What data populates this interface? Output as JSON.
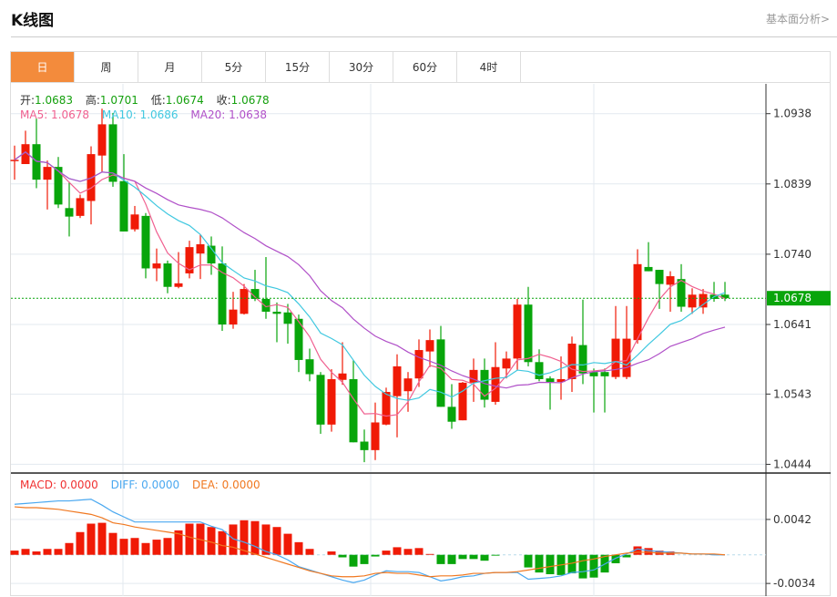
{
  "header": {
    "title": "K线图",
    "link": "基本面分析>"
  },
  "tabs": [
    {
      "label": "日",
      "active": true
    },
    {
      "label": "周"
    },
    {
      "label": "月"
    },
    {
      "label": "5分"
    },
    {
      "label": "15分"
    },
    {
      "label": "30分"
    },
    {
      "label": "60分"
    },
    {
      "label": "4时"
    }
  ],
  "ohlc_legend": {
    "open_label": "开:",
    "open": "1.0683",
    "high_label": "高:",
    "high": "1.0701",
    "low_label": "低:",
    "low": "1.0674",
    "close_label": "收:",
    "close": "1.0678"
  },
  "ma_legend": {
    "ma5": "MA5: 1.0678",
    "ma10": "MA10: 1.0686",
    "ma20": "MA20: 1.0638"
  },
  "macd_legend": {
    "macd": "MACD: 0.0000",
    "diff": "DIFF: 0.0000",
    "dea": "DEA: 0.0000"
  },
  "colors": {
    "up": "#f01a06",
    "down": "#08a50b",
    "ma5": "#f06090",
    "ma10": "#40c8e0",
    "ma20": "#b050c8",
    "diff": "#4aa8f0",
    "dea": "#f07820",
    "accent": "#f38b3c",
    "last_price_bg": "#08a50b"
  },
  "chart_data": [
    {
      "type": "candlestick",
      "title": "K线图",
      "yticks": [
        "1.0938",
        "1.0839",
        "1.0740",
        "1.0641",
        "1.0543",
        "1.0444"
      ],
      "ylim": [
        1.0433,
        1.098
      ],
      "last_price": "1.0678",
      "grid": true,
      "ohlc": [
        [
          1.0872,
          1.0893,
          1.0845,
          1.0873
        ],
        [
          1.0867,
          1.0914,
          1.0867,
          1.0895
        ],
        [
          1.0895,
          1.0931,
          1.0833,
          1.0845
        ],
        [
          1.0845,
          1.0872,
          1.0803,
          1.0863
        ],
        [
          1.0863,
          1.0877,
          1.0805,
          1.081
        ],
        [
          1.0805,
          1.0842,
          1.0765,
          1.0793
        ],
        [
          1.0794,
          1.0824,
          1.0791,
          1.0819
        ],
        [
          1.0815,
          1.0892,
          1.0782,
          1.0881
        ],
        [
          1.0879,
          1.0945,
          1.0856,
          1.0923
        ],
        [
          1.0923,
          1.0939,
          1.0835,
          1.0842
        ],
        [
          1.0843,
          1.0881,
          1.0772,
          1.0772
        ],
        [
          1.0775,
          1.0808,
          1.0772,
          1.0796
        ],
        [
          1.0794,
          1.0798,
          1.0706,
          1.072
        ],
        [
          1.072,
          1.0748,
          1.0702,
          1.0727
        ],
        [
          1.0727,
          1.0731,
          1.0685,
          1.0694
        ],
        [
          1.0694,
          1.0743,
          1.0692,
          1.0699
        ],
        [
          1.0713,
          1.0759,
          1.0706,
          1.075
        ],
        [
          1.0741,
          1.0768,
          1.0705,
          1.0754
        ],
        [
          1.0752,
          1.0765,
          1.0711,
          1.0727
        ],
        [
          1.0727,
          1.0751,
          1.0632,
          1.0641
        ],
        [
          1.0641,
          1.0687,
          1.0635,
          1.0662
        ],
        [
          1.0656,
          1.0698,
          1.0655,
          1.0691
        ],
        [
          1.0691,
          1.0718,
          1.0674,
          1.0677
        ],
        [
          1.0677,
          1.0736,
          1.0649,
          1.0659
        ],
        [
          1.0659,
          1.0672,
          1.0616,
          1.0656
        ],
        [
          1.0658,
          1.067,
          1.0614,
          1.0642
        ],
        [
          1.0649,
          1.0655,
          1.0574,
          1.0591
        ],
        [
          1.0592,
          1.0607,
          1.0561,
          1.0571
        ],
        [
          1.057,
          1.0574,
          1.0487,
          1.05
        ],
        [
          1.05,
          1.0578,
          1.049,
          1.0564
        ],
        [
          1.0563,
          1.0616,
          1.0556,
          1.0572
        ],
        [
          1.0564,
          1.0591,
          1.0475,
          1.0475
        ],
        [
          1.0476,
          1.0493,
          1.0447,
          1.0464
        ],
        [
          1.0464,
          1.0531,
          1.045,
          1.0503
        ],
        [
          1.05,
          1.0552,
          1.0499,
          1.0546
        ],
        [
          1.054,
          1.0599,
          1.0482,
          1.0582
        ],
        [
          1.0547,
          1.0574,
          1.0518,
          1.0565
        ],
        [
          1.0565,
          1.062,
          1.0553,
          1.0605
        ],
        [
          1.0603,
          1.0634,
          1.0581,
          1.0619
        ],
        [
          1.062,
          1.0639,
          1.0525,
          1.0525
        ],
        [
          1.0525,
          1.0557,
          1.0494,
          1.0504
        ],
        [
          1.0506,
          1.056,
          1.0506,
          1.0559
        ],
        [
          1.0559,
          1.0593,
          1.0532,
          1.0577
        ],
        [
          1.0577,
          1.0593,
          1.0524,
          1.0535
        ],
        [
          1.0532,
          1.0616,
          1.0528,
          1.0581
        ],
        [
          1.0579,
          1.0603,
          1.0565,
          1.0593
        ],
        [
          1.0593,
          1.0677,
          1.0577,
          1.0669
        ],
        [
          1.0669,
          1.0694,
          1.0582,
          1.0588
        ],
        [
          1.0588,
          1.0606,
          1.0561,
          1.0564
        ],
        [
          1.0565,
          1.0568,
          1.0521,
          1.056
        ],
        [
          1.056,
          1.0596,
          1.0535,
          1.0564
        ],
        [
          1.0564,
          1.0624,
          1.0546,
          1.0614
        ],
        [
          1.0612,
          1.0676,
          1.0557,
          1.0572
        ],
        [
          1.0574,
          1.0579,
          1.0517,
          1.0568
        ],
        [
          1.0574,
          1.0579,
          1.0517,
          1.0568
        ],
        [
          1.0567,
          1.0667,
          1.0564,
          1.0621
        ],
        [
          1.0567,
          1.0667,
          1.0564,
          1.0621
        ],
        [
          1.0619,
          1.0747,
          1.0614,
          1.0726
        ],
        [
          1.0722,
          1.0757,
          1.0716,
          1.0716
        ],
        [
          1.0718,
          1.0718,
          1.0663,
          1.0698
        ],
        [
          1.0697,
          1.0716,
          1.0659,
          1.0709
        ],
        [
          1.0705,
          1.0726,
          1.0659,
          1.0666
        ],
        [
          1.0665,
          1.0692,
          1.0656,
          1.0683
        ],
        [
          1.0665,
          1.0691,
          1.0656,
          1.0684
        ],
        [
          1.0683,
          1.0701,
          1.0673,
          1.0677
        ],
        [
          1.0683,
          1.0701,
          1.0674,
          1.0678
        ]
      ]
    },
    {
      "type": "macd",
      "yticks": [
        "0.0042",
        "-0.0034"
      ],
      "ylim": [
        -0.0049,
        0.0096
      ],
      "macd": [
        0.0005,
        0.0007,
        0.0004,
        0.0007,
        0.0007,
        0.0014,
        0.0027,
        0.0037,
        0.0038,
        0.0026,
        0.0019,
        0.002,
        0.0014,
        0.0018,
        0.002,
        0.0029,
        0.0037,
        0.0037,
        0.0033,
        0.0028,
        0.0036,
        0.0041,
        0.004,
        0.0036,
        0.0033,
        0.0025,
        0.0015,
        0.0007,
        0.0,
        0.0004,
        -0.0003,
        -0.0014,
        -0.0011,
        -0.0002,
        0.0005,
        0.0009,
        0.0007,
        0.0008,
        0.0001,
        -0.0011,
        -0.0011,
        -0.0005,
        -0.0005,
        -0.0007,
        -0.0001,
        0.0,
        0.0,
        -0.0015,
        -0.0021,
        -0.0023,
        -0.0024,
        -0.0022,
        -0.0028,
        -0.0027,
        -0.0021,
        -0.001,
        -0.0003,
        0.001,
        0.0008,
        0.0005,
        0.0004,
        0.0,
        0.0,
        0.0,
        0.0,
        0.0
      ],
      "diff": [
        0.006,
        0.0061,
        0.0062,
        0.0063,
        0.0064,
        0.0064,
        0.0065,
        0.0066,
        0.0059,
        0.0051,
        0.0045,
        0.0039,
        0.0039,
        0.0039,
        0.0039,
        0.0039,
        0.0039,
        0.0039,
        0.0034,
        0.003,
        0.0019,
        0.0015,
        0.001,
        0.0004,
        0.0,
        -0.0006,
        -0.0014,
        -0.0018,
        -0.0022,
        -0.0026,
        -0.003,
        -0.0033,
        -0.003,
        -0.0024,
        -0.0019,
        -0.002,
        -0.002,
        -0.0021,
        -0.0026,
        -0.0031,
        -0.0029,
        -0.0026,
        -0.0025,
        -0.0022,
        -0.0021,
        -0.0021,
        -0.0021,
        -0.0029,
        -0.0028,
        -0.0027,
        -0.0025,
        -0.0021,
        -0.002,
        -0.0018,
        -0.0011,
        -0.0004,
        0.0001,
        0.0007,
        0.0005,
        0.0004,
        0.0003,
        0.0002,
        0.0001,
        0.0001,
        0.0,
        0.0
      ],
      "dea": [
        0.0057,
        0.0056,
        0.0056,
        0.0055,
        0.0054,
        0.0052,
        0.005,
        0.0048,
        0.0044,
        0.0038,
        0.0036,
        0.0033,
        0.0031,
        0.0029,
        0.0027,
        0.0025,
        0.0021,
        0.0018,
        0.0015,
        0.0011,
        0.0009,
        0.0005,
        0.0001,
        -0.0003,
        -0.0007,
        -0.0011,
        -0.0015,
        -0.0019,
        -0.0022,
        -0.0025,
        -0.0026,
        -0.0026,
        -0.0025,
        -0.0022,
        -0.0021,
        -0.0022,
        -0.0022,
        -0.0024,
        -0.0026,
        -0.0025,
        -0.0025,
        -0.0024,
        -0.0022,
        -0.0022,
        -0.0021,
        -0.0021,
        -0.002,
        -0.0018,
        -0.0016,
        -0.0014,
        -0.0012,
        -0.001,
        -0.0007,
        -0.0005,
        -0.0002,
        0.0,
        0.0002,
        0.0003,
        0.0003,
        0.0002,
        0.0002,
        0.0002,
        0.0001,
        0.0001,
        0.0001,
        0.0
      ]
    }
  ]
}
